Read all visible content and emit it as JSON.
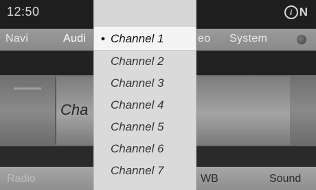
{
  "status": {
    "time": "12:50",
    "info_symbol": "i",
    "indicator": "N"
  },
  "main_menu": {
    "items": [
      {
        "label": "Navi",
        "active": false
      },
      {
        "label": "Audi",
        "active": true
      },
      {
        "label": "eo",
        "active": false
      },
      {
        "label": "System",
        "active": false
      }
    ]
  },
  "content": {
    "partial_title": "Cha"
  },
  "bottom_bar": {
    "left_label": "Radio",
    "wb_label": "WB",
    "sound_label": "Sound"
  },
  "channel_list": {
    "items": [
      "Channel 1",
      "Channel 2",
      "Channel 3",
      "Channel 4",
      "Channel 5",
      "Channel 6",
      "Channel 7"
    ],
    "selected_index": 0,
    "bullet": "•"
  }
}
